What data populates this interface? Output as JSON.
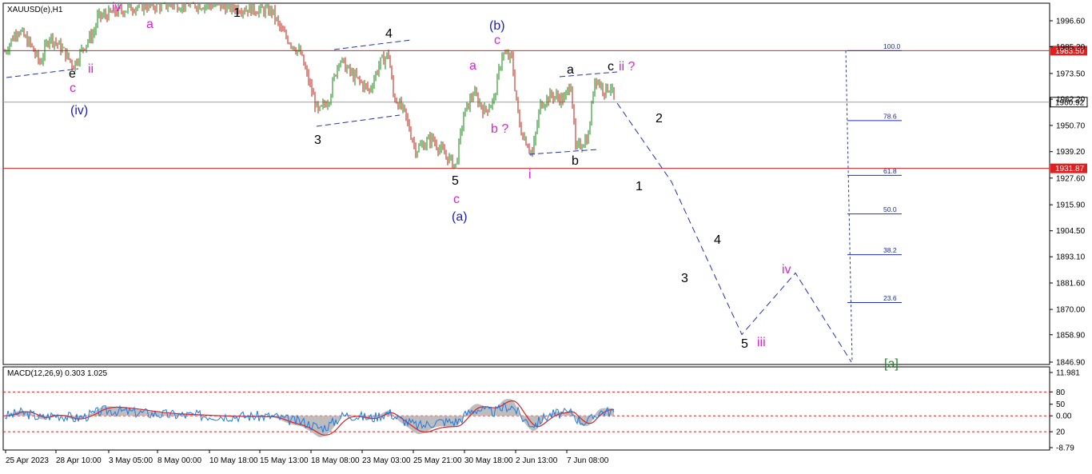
{
  "instrument_label": "XAUUSD(e),H1",
  "colors": {
    "bull_candle": "#0b8a0b",
    "bear_candle": "#c31a0a",
    "level_line": "#e02020",
    "projection": "#2030c0",
    "wave_black": "#000000",
    "wave_magenta": "#e020d0",
    "wave_blue": "#1a1ad0",
    "wave_green": "#1d8a1d",
    "macd_hist": "#bdbdbd",
    "macd_main": "#1e78e6",
    "macd_signal": "#dd2020"
  },
  "chart_data": [
    {
      "type": "candlestick",
      "y_ticks": [
        "1996.60",
        "1985.20",
        "1973.50",
        "1962.20",
        "1950.70",
        "1939.20",
        "1927.60",
        "1915.90",
        "1904.50",
        "1893.10",
        "1881.60",
        "1870.00",
        "1858.90",
        "1846.90"
      ],
      "ylim": [
        1846.9,
        1996.6
      ],
      "x_ticks": [
        "25 Apr 2023",
        "28 Apr 10:00",
        "3 May 05:00",
        "8 May 00:00",
        "10 May 18:00",
        "15 May 13:00",
        "18 May 08:00",
        "23 May 03:00",
        "25 May 21:00",
        "30 May 18:00",
        "2 Jun 13:00",
        "7 Jun 08:00"
      ],
      "price_levels": [
        {
          "label": "1983.50",
          "value": 1983.5
        },
        {
          "label": "1931.87",
          "value": 1931.87
        }
      ],
      "current_price": {
        "label": "1960.92",
        "value": 1960.92
      },
      "fib_levels": [
        {
          "label": "100.0",
          "value": 1983.5
        },
        {
          "label": "78.6",
          "value": 1952.8
        },
        {
          "label": "61.8",
          "value": 1928.8
        },
        {
          "label": "50.0",
          "value": 1911.9
        },
        {
          "label": "38.2",
          "value": 1894.0
        },
        {
          "label": "23.6",
          "value": 1873.0
        }
      ],
      "wave_labels": [
        {
          "text": "e",
          "color": "black"
        },
        {
          "text": "c",
          "color": "magenta"
        },
        {
          "text": "(iv)",
          "color": "blue"
        },
        {
          "text": "ii",
          "color": "magenta"
        },
        {
          "text": "iv",
          "color": "magenta"
        },
        {
          "text": "a",
          "color": "magenta"
        },
        {
          "text": "1",
          "color": "black"
        },
        {
          "text": "4",
          "color": "black"
        },
        {
          "text": "3",
          "color": "black"
        },
        {
          "text": "5",
          "color": "black"
        },
        {
          "text": "c",
          "color": "magenta"
        },
        {
          "text": "(a)",
          "color": "blue"
        },
        {
          "text": "(b)",
          "color": "blue"
        },
        {
          "text": "c",
          "color": "magenta"
        },
        {
          "text": "a",
          "color": "magenta"
        },
        {
          "text": "b ?",
          "color": "magenta"
        },
        {
          "text": "i",
          "color": "magenta"
        },
        {
          "text": "a",
          "color": "black"
        },
        {
          "text": "b",
          "color": "black"
        },
        {
          "text": "c",
          "color": "black"
        },
        {
          "text": "ii ?",
          "color": "magenta"
        },
        {
          "text": "2",
          "color": "black"
        },
        {
          "text": "1",
          "color": "black"
        },
        {
          "text": "4",
          "color": "black"
        },
        {
          "text": "3",
          "color": "black"
        },
        {
          "text": "5",
          "color": "black"
        },
        {
          "text": "iii",
          "color": "magenta"
        },
        {
          "text": "iv",
          "color": "magenta"
        },
        {
          "text": "[a]",
          "color": "green"
        }
      ],
      "projection_path": [
        {
          "x": "7 Jun 08:00+",
          "y": 1960.5
        },
        {
          "y": 1926.0
        },
        {
          "y": 1859.0
        },
        {
          "y": 1886.0
        },
        {
          "y": 1846.9
        }
      ]
    },
    {
      "type": "line",
      "title": "MACD(12,26,9) 0.303 1.025",
      "y_ticks": [
        "11.981",
        "80",
        "50",
        "0.00",
        "20",
        "-8.79"
      ],
      "ylim": [
        -8.79,
        11.981
      ],
      "series": [
        {
          "name": "MACD",
          "style": "histogram"
        },
        {
          "name": "Signal",
          "style": "line"
        }
      ]
    }
  ]
}
